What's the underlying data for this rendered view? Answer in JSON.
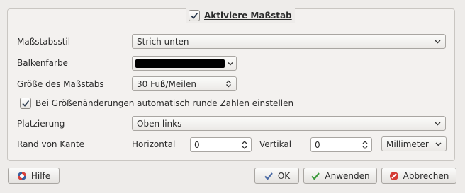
{
  "header": {
    "enable_label": "Aktiviere Maßstab",
    "enabled": true
  },
  "form": {
    "style_label": "Maßstabsstil",
    "style_value": "Strich unten",
    "color_label": "Balkenfarbe",
    "bar_color": "#000000",
    "size_label": "Größe des Maßstabs",
    "size_value": "30 Fuß/Meilen",
    "round_label": "Bei Größenänderungen automatisch runde Zahlen einstellen",
    "round_checked": true,
    "placement_label": "Platzierung",
    "placement_value": "Oben links",
    "margin_label": "Rand von Kante",
    "horizontal_label": "Horizontal",
    "horizontal_value": "0",
    "vertical_label": "Vertikal",
    "vertical_value": "0",
    "unit_value": "Millimeter"
  },
  "buttons": {
    "help": "Hilfe",
    "ok": "OK",
    "apply": "Anwenden",
    "cancel": "Abbrechen"
  },
  "icons": {
    "help": "help-lifebuoy-icon",
    "ok": "checkmark-icon",
    "apply": "green-checkmark-icon",
    "cancel": "cancel-icon"
  }
}
